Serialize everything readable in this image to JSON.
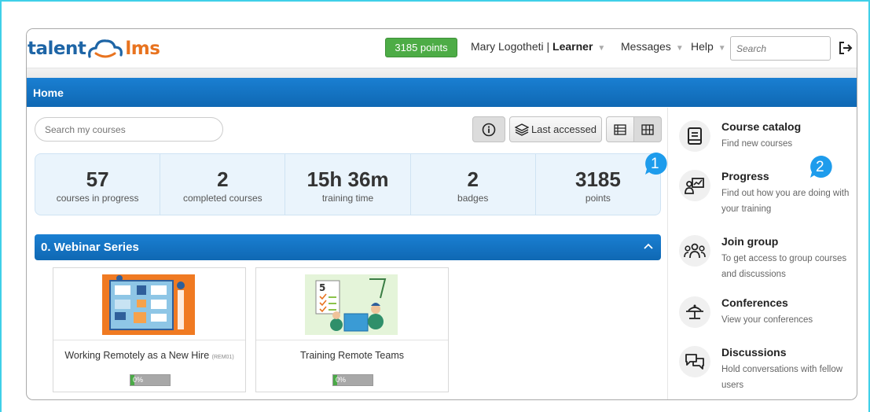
{
  "header": {
    "logo_left": "talent",
    "logo_right": "lms",
    "points_button": "3185 points",
    "user_name": "Mary Logotheti",
    "user_sep": " | ",
    "user_role": "Learner",
    "messages": "Messages",
    "help": "Help",
    "search_placeholder": "Search"
  },
  "home": {
    "title": "Home"
  },
  "toolbar": {
    "search_placeholder": "Search my courses",
    "last_accessed": "Last accessed"
  },
  "stats": [
    {
      "value": "57",
      "label": "courses in progress"
    },
    {
      "value": "2",
      "label": "completed courses"
    },
    {
      "value": "15h 36m",
      "label": "training time"
    },
    {
      "value": "2",
      "label": "badges"
    },
    {
      "value": "3185",
      "label": "points"
    }
  ],
  "category": {
    "title": "0. Webinar Series"
  },
  "courses": [
    {
      "title": "Working Remotely as a New Hire",
      "code": "(REM01)",
      "progress_text": "0%",
      "progress": 0.1
    },
    {
      "title": "Training Remote Teams",
      "code": "",
      "progress_text": "0%",
      "progress": 0.1
    }
  ],
  "right_panel": [
    {
      "title": "Course catalog",
      "desc": "Find new courses",
      "icon": "book-icon"
    },
    {
      "title": "Progress",
      "desc": "Find out how you are doing with your training",
      "icon": "progress-chart-icon"
    },
    {
      "title": "Join group",
      "desc": "To get access to group courses and discussions",
      "icon": "group-icon"
    },
    {
      "title": "Conferences",
      "desc": "View your conferences",
      "icon": "conference-icon"
    },
    {
      "title": "Discussions",
      "desc": "Hold conversations with fellow users",
      "icon": "chat-bubbles-icon"
    }
  ],
  "callouts": [
    "1",
    "2"
  ],
  "colors": {
    "accent_blue": "#1a7fd2",
    "green": "#4dac46",
    "callout": "#1e9cec",
    "frame": "#3fd0e8"
  }
}
